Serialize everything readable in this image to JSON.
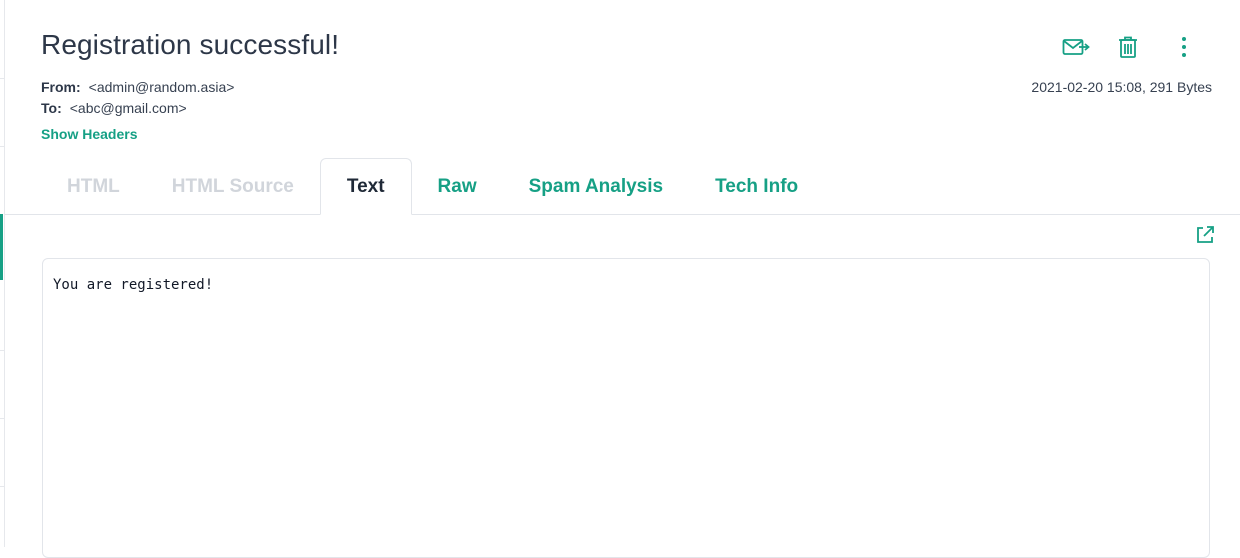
{
  "email": {
    "subject": "Registration successful!",
    "from_label": "From:",
    "from_value": "<admin@random.asia>",
    "to_label": "To:",
    "to_value": "<abc@gmail.com>",
    "show_headers": "Show Headers",
    "date_size": "2021-02-20 15:08, 291 Bytes",
    "body": "You are registered!"
  },
  "actions": {
    "forward_icon": "forward-mail-icon",
    "delete_icon": "trash-icon",
    "more_icon": "more-vertical-icon",
    "open_external_icon": "external-link-icon"
  },
  "tabs": [
    {
      "label": "HTML",
      "state": "disabled"
    },
    {
      "label": "HTML Source",
      "state": "disabled"
    },
    {
      "label": "Text",
      "state": "active"
    },
    {
      "label": "Raw",
      "state": "link"
    },
    {
      "label": "Spam Analysis",
      "state": "link"
    },
    {
      "label": "Tech Info",
      "state": "link"
    }
  ],
  "colors": {
    "accent": "#16a085",
    "text": "#1f2937",
    "disabled": "#d1d5db",
    "border": "#e2e5ea"
  }
}
